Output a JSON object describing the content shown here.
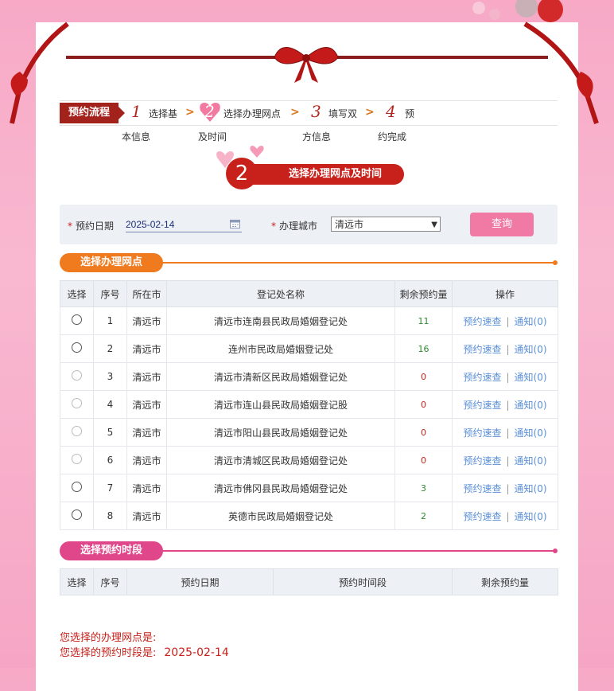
{
  "steps": {
    "title": "预约流程",
    "items": [
      {
        "num": "1",
        "label": "选择基",
        "sub": "本信息"
      },
      {
        "num": "2",
        "label": "选择办理网点",
        "sub": "及时间"
      },
      {
        "num": "3",
        "label": "填写双",
        "sub": "方信息"
      },
      {
        "num": "4",
        "label": "预",
        "sub": "约完成"
      }
    ]
  },
  "current_step": {
    "num": "2",
    "label": "选择办理网点及时间"
  },
  "form": {
    "date_label": "预约日期",
    "date_value": "2025-02-14",
    "city_label": "办理城市",
    "city_value": "清远市",
    "query_label": "查询"
  },
  "section1": {
    "title": "选择办理网点",
    "color": "#f07a1e"
  },
  "table1": {
    "headers": [
      "选择",
      "序号",
      "所在市",
      "登记处名称",
      "剩余预约量",
      "操作"
    ],
    "rows": [
      {
        "no": "1",
        "city": "清远市",
        "name": "清远市连南县民政局婚姻登记处",
        "remain": "11",
        "enabled": true
      },
      {
        "no": "2",
        "city": "清远市",
        "name": "连州市民政局婚姻登记处",
        "remain": "16",
        "enabled": true
      },
      {
        "no": "3",
        "city": "清远市",
        "name": "清远市清新区民政局婚姻登记处",
        "remain": "0",
        "enabled": false
      },
      {
        "no": "4",
        "city": "清远市",
        "name": "清远市连山县民政局婚姻登记股",
        "remain": "0",
        "enabled": false
      },
      {
        "no": "5",
        "city": "清远市",
        "name": "清远市阳山县民政局婚姻登记处",
        "remain": "0",
        "enabled": false
      },
      {
        "no": "6",
        "city": "清远市",
        "name": "清远市清城区民政局婚姻登记处",
        "remain": "0",
        "enabled": false
      },
      {
        "no": "7",
        "city": "清远市",
        "name": "清远市佛冈县民政局婚姻登记处",
        "remain": "3",
        "enabled": true
      },
      {
        "no": "8",
        "city": "清远市",
        "name": "英德市民政局婚姻登记处",
        "remain": "2",
        "enabled": true
      }
    ],
    "link_speed": "预约速查",
    "link_notice": "通知(0)",
    "sep": "|"
  },
  "section2": {
    "title": "选择预约时段",
    "color": "#e0468a"
  },
  "table2": {
    "headers": [
      "选择",
      "序号",
      "预约日期",
      "预约时间段",
      "剩余预约量"
    ]
  },
  "result": {
    "site_label": "您选择的办理网点是:",
    "time_label": "您选择的预约时段是:",
    "time_value": "2025-02-14"
  },
  "colors": {
    "accent_red": "#c8201a",
    "pink_button": "#f07aa4",
    "link": "#5a8fd6"
  }
}
